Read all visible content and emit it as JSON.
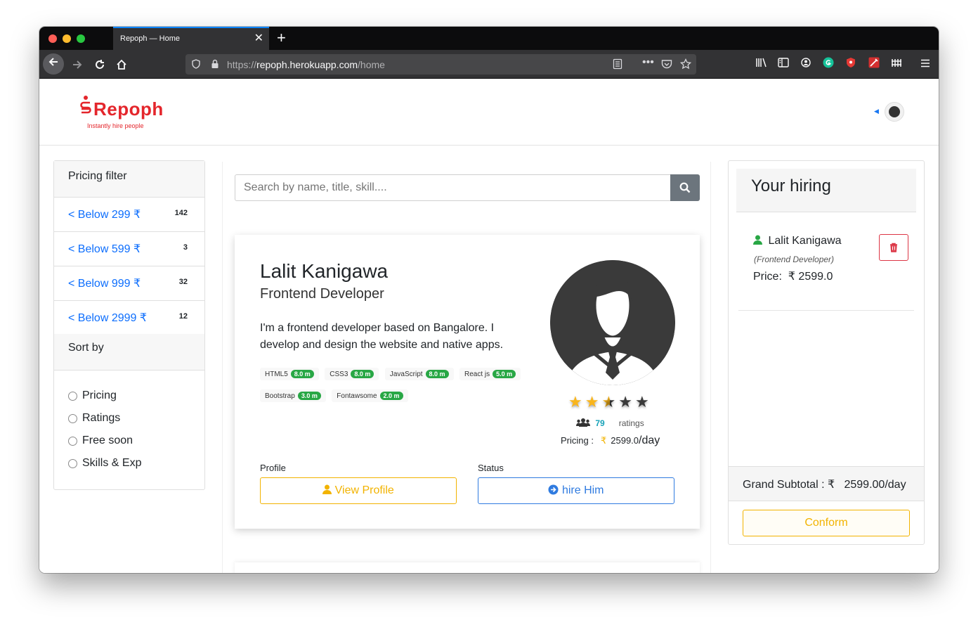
{
  "browser": {
    "tab_title": "Repoph — Home",
    "tab_close": "✕",
    "new_tab": "+",
    "url_scheme": "https://",
    "url_host": "repoph.herokuapp.com",
    "url_path": "/home"
  },
  "header": {
    "logo_text": "Repoph",
    "logo_tagline": "Instantly hire people"
  },
  "pricing_filter": {
    "title": "Pricing filter",
    "items": [
      {
        "label": "< Below 299 ₹",
        "count": "142"
      },
      {
        "label": "< Below 599 ₹",
        "count": "3"
      },
      {
        "label": "< Below 999 ₹",
        "count": "32"
      },
      {
        "label": "< Below 2999 ₹",
        "count": "12"
      }
    ]
  },
  "sort_by": {
    "title": "Sort by",
    "options": [
      "Pricing",
      "Ratings",
      "Free soon",
      "Skills & Exp"
    ]
  },
  "search": {
    "placeholder": "Search by name, title, skill...."
  },
  "profile": {
    "name": "Lalit Kanigawa",
    "title": "Frontend Developer",
    "description": "I'm a frontend developer based on Bangalore. I develop and design the website and native apps.",
    "skills": [
      {
        "name": "HTML5",
        "exp": "8.0 m"
      },
      {
        "name": "CSS3",
        "exp": "8.0 m"
      },
      {
        "name": "JavaScript",
        "exp": "8.0 m"
      },
      {
        "name": "React js",
        "exp": "5.0 m"
      },
      {
        "name": "Bootstrap",
        "exp": "3.0 m"
      },
      {
        "name": "Fontawsome",
        "exp": "2.0 m"
      }
    ],
    "rating": 2.5,
    "rating_max": 5,
    "ratings_count": "79",
    "ratings_label": "ratings",
    "pricing_label": "Pricing :",
    "currency": "₹",
    "price_value": "2599.0",
    "price_unit": "/day",
    "profile_label": "Profile",
    "status_label": "Status",
    "view_profile_label": "View Profile",
    "hire_label": "hire Him"
  },
  "hiring": {
    "title": "Your hiring",
    "name": "Lalit Kanigawa",
    "role": "(Frontend Developer)",
    "price_label": "Price:",
    "price_value": "₹ 2599.0",
    "subtotal_label": "Grand Subtotal : ₹",
    "subtotal_value": "2599.00/day",
    "confirm_label": "Conform"
  },
  "colors": {
    "brand": "#e4262c",
    "link": "#0d6efd",
    "warning": "#f2b300",
    "primary": "#2f7be0",
    "success": "#28a745",
    "danger": "#dc3545"
  }
}
